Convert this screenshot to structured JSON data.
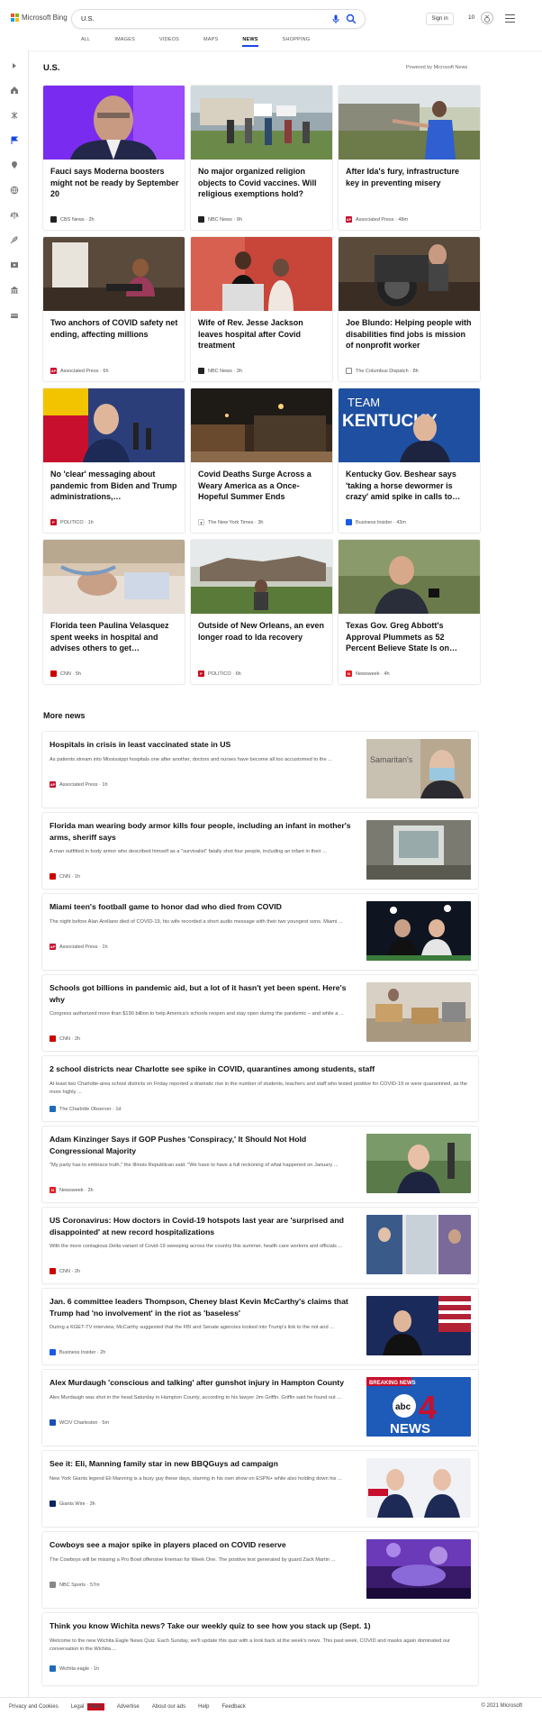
{
  "header": {
    "brand": "Microsoft Bing",
    "query": "U.S.",
    "signin": "Sign in",
    "rewards_count": "10",
    "tabs": [
      "ALL",
      "IMAGES",
      "VIDEOS",
      "MAPS",
      "NEWS",
      "SHOPPING"
    ],
    "active_tab": "NEWS"
  },
  "section": {
    "title": "U.S.",
    "powered_by": "Powered by Microsoft News"
  },
  "rail_icons": [
    "expand-icon",
    "home-icon",
    "science-icon",
    "flag-icon",
    "location-icon",
    "globe-icon",
    "scales-icon",
    "rocket-icon",
    "movie-icon",
    "bank-icon",
    "sports-icon"
  ],
  "cards": [
    {
      "title": "Fauci says Moderna boosters might not be ready by September 20",
      "source": "CBS News",
      "age": "2h",
      "logo_color": "#222"
    },
    {
      "title": "No major organized religion objects to Covid vaccines. Will religious exemptions hold?",
      "source": "NBC News",
      "age": "9h",
      "logo_color": "#222"
    },
    {
      "title": "After Ida's fury, infrastructure key in preventing misery",
      "source": "Associated Press",
      "age": "48m",
      "logo_color": "#c8102e"
    },
    {
      "title": "Two anchors of COVID safety net ending, affecting millions",
      "source": "Associated Press",
      "age": "6h",
      "logo_color": "#c8102e"
    },
    {
      "title": "Wife of Rev. Jesse Jackson leaves hospital after Covid treatment",
      "source": "NBC News",
      "age": "3h",
      "logo_color": "#222"
    },
    {
      "title": "Joe Blundo: Helping people with disabilities find jobs is mission of nonprofit worker",
      "source": "The Columbus Dispatch",
      "age": "8h",
      "logo_color": "#555"
    },
    {
      "title": "No 'clear' messaging about pandemic from Biden and Trump administrations,…",
      "source": "POLITICO",
      "age": "1h",
      "logo_color": "#c50f1f"
    },
    {
      "title": "Covid Deaths Surge Across a Weary America as a Once-Hopeful Summer Ends",
      "source": "The New York Times",
      "age": "3h",
      "logo_color": "#222"
    },
    {
      "title": "Kentucky Gov. Beshear says 'taking a horse dewormer is crazy' amid spike in calls to…",
      "source": "Business Insider",
      "age": "43m",
      "logo_color": "#1a5be2"
    },
    {
      "title": "Florida teen Paulina Velasquez spent weeks in hospital and advises others to get…",
      "source": "CNN",
      "age": "5h",
      "logo_color": "#cc0000"
    },
    {
      "title": "Outside of New Orleans, an even longer road to Ida recovery",
      "source": "POLITICO",
      "age": "6h",
      "logo_color": "#c50f1f"
    },
    {
      "title": "Texas Gov. Greg Abbott's Approval Plummets as 52 Percent Believe State Is on…",
      "source": "Newsweek",
      "age": "4h",
      "logo_color": "#e01e24"
    }
  ],
  "more_news_title": "More news",
  "more_news": [
    {
      "title": "Hospitals in crisis in least vaccinated state in US",
      "snippet": "As patients stream into Mississippi hospitals one after another, doctors and nurses have become all too accustomed to the ...",
      "source": "Associated Press",
      "age": "1h",
      "logo_color": "#c8102e"
    },
    {
      "title": "Florida man wearing body armor kills four people, including an infant in mother's arms, sheriff says",
      "snippet": "A man outfitted in body armor who described himself as a \"survivalist\" fatally shot four people, including an infant in their ...",
      "source": "CNN",
      "age": "1h",
      "logo_color": "#cc0000"
    },
    {
      "title": "Miami teen's football game to honor dad who died from COVID",
      "snippet": "The night before Alan Arellano died of COVID-19, his wife recorded a short audio message with their two youngest sons. Miami ...",
      "source": "Associated Press",
      "age": "1h",
      "logo_color": "#c8102e"
    },
    {
      "title": "Schools got billions in pandemic aid, but a lot of it hasn't yet been spent. Here's why",
      "snippet": "Congress authorized more than $190 billion to help America's schools reopen and stay open during the pandemic – and while a ...",
      "source": "CNN",
      "age": "2h",
      "logo_color": "#cc0000"
    },
    {
      "title": "2 school districts near Charlotte see spike in COVID, quarantines among students, staff",
      "snippet": "At least two Charlotte-area school districts on Friday reported a dramatic rise in the number of students, teachers and staff who tested positive for COVID-19 or were quarantined, as the more highly ...",
      "source": "The Charlotte Observer",
      "age": "1d",
      "logo_color": "#1e6bb8"
    },
    {
      "title": "Adam Kinzinger Says if GOP Pushes 'Conspiracy,' It Should Not Hold Congressional Majority",
      "snippet": "\"My party has to embrace truth,\" the Illinois Republican said. \"We have to have a full reckoning of what happened on January ...",
      "source": "Newsweek",
      "age": "2h",
      "logo_color": "#e01e24"
    },
    {
      "title": "US Coronavirus: How doctors in Covid-19 hotspots last year are 'surprised and disappointed' at new record hospitalizations",
      "snippet": "With the more contagious Delta variant of Covid-19 sweeping across the country this summer, health care workers and officials ...",
      "source": "CNN",
      "age": "2h",
      "logo_color": "#cc0000"
    },
    {
      "title": "Jan. 6 committee leaders Thompson, Cheney blast Kevin McCarthy's claims that Trump had 'no involvement' in the riot as 'baseless'",
      "snippet": "During a KGET-TV interview, McCarthy suggested that the FBI and Senate agencies looked into Trump's link to the riot and ...",
      "source": "Business Insider",
      "age": "2h",
      "logo_color": "#1a5be2"
    },
    {
      "title": "Alex Murdaugh 'conscious and talking' after gunshot injury in Hampton County",
      "snippet": "Alex Murdaugh was shot in the head Saturday in Hampton County, according to his lawyer Jim Griffin. Griffin said he found out ...",
      "source": "WCIV Charleston",
      "age": "5m",
      "logo_color": "#1a4fb8"
    },
    {
      "title": "See it: Eli, Manning family star in new BBQGuys ad campaign",
      "snippet": "New York Giants legend Eli Manning is a busy guy these days, starring in his own show on ESPN+ while also holding down his ...",
      "source": "Giants Wire",
      "age": "3h",
      "logo_color": "#0b2265"
    },
    {
      "title": "Cowboys see a major spike in players placed on COVID reserve",
      "snippet": "The Cowboys will be missing a Pro Bowl offensive lineman for Week One. The positive test generated by guard Zack Martin ...",
      "source": "NBC Sports",
      "age": "57m",
      "logo_color": "#888"
    },
    {
      "title": "Think you know Wichita news? Take our weekly quiz to see how you stack up (Sept. 1)",
      "snippet": "Welcome to the new Wichita Eagle News Quiz. Each Sunday, we'll update this quiz with a look back at the week's news. This past week, COVID and masks again dominated our conversation in the Wichita ...",
      "source": "Wichita eagle",
      "age": "1h",
      "logo_color": "#1e6bb8"
    }
  ],
  "thumb_labels": {
    "samaritans": "Samaritan's",
    "breaking": "BREAKING NEWS",
    "abc": "abc",
    "abc_num": "4",
    "news": "NEWS",
    "kentucky_team": "TEAM",
    "kentucky": "KENTUCKY"
  },
  "footer": {
    "links": [
      "Privacy and Cookies",
      "Legal",
      "Advertise",
      "About our ads",
      "Help",
      "Feedback"
    ],
    "new_badge": "New",
    "copyright": "© 2021 Microsoft"
  }
}
